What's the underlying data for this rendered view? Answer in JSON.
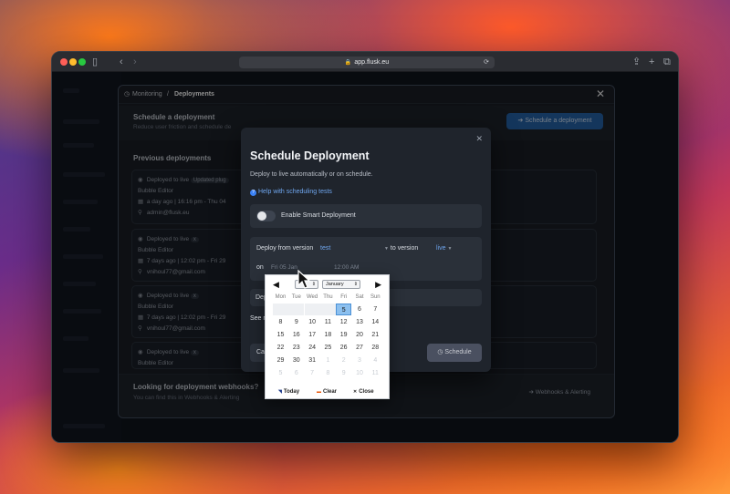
{
  "browser": {
    "url": "app.flusk.eu"
  },
  "header": {
    "crumb_monitoring": "Monitoring",
    "crumb_separator": "/",
    "crumb_deployments": "Deployments"
  },
  "schedule_section": {
    "title": "Schedule a deployment",
    "subtitle": "Reduce user friction and schedule de",
    "button": "Schedule a deployment"
  },
  "previous": {
    "title": "Previous deployments",
    "cards": [
      {
        "status": "Deployed to live",
        "tag": "Updated plug",
        "app": "Bubble Editor",
        "time": "a day ago | 16:16 pm - Thu 04",
        "user": "admin@flusk.eu"
      },
      {
        "status": "Deployed to live",
        "tag": "x",
        "app": "Bubble Editor",
        "time": "7 days ago | 12:02 pm - Fri 29",
        "user": "vnihoul77@gmail.com"
      },
      {
        "status": "Deployed to live",
        "tag": "x",
        "app": "Bubble Editor",
        "time": "7 days ago | 12:02 pm - Fri 29",
        "user": "vnihoul77@gmail.com"
      },
      {
        "status": "Deployed to live",
        "tag": "x",
        "app": "Bubble Editor"
      }
    ]
  },
  "webhooks": {
    "title": "Looking for deployment webhooks?",
    "subtitle": "You can find this in Webhooks & Alerting",
    "link": "Webhooks & Alerting"
  },
  "modal": {
    "title": "Schedule Deployment",
    "description": "Deploy to live automatically or on schedule.",
    "help_link": "Help with scheduling tests",
    "smart_label": "Enable Smart Deployment",
    "deploy_from_label": "Deploy from version",
    "from_version": "test",
    "to_version_label": "to version",
    "to_version": "live",
    "on_label": "on",
    "date_placeholder": "Fri 05 Jan",
    "time_placeholder": "12:00 AM",
    "row2_label": "Dep",
    "see_text": "See re",
    "cancel": "Ca",
    "schedule": "Schedule"
  },
  "calendar": {
    "month": "January",
    "year": "",
    "weekdays": [
      "Mon",
      "Tue",
      "Wed",
      "Thu",
      "Fri",
      "Sat",
      "Sun"
    ],
    "rows": [
      [
        "",
        "",
        "",
        "",
        "5",
        "6",
        "7"
      ],
      [
        "8",
        "9",
        "10",
        "11",
        "12",
        "13",
        "14"
      ],
      [
        "15",
        "16",
        "17",
        "18",
        "19",
        "20",
        "21"
      ],
      [
        "22",
        "23",
        "24",
        "25",
        "26",
        "27",
        "28"
      ],
      [
        "29",
        "30",
        "31",
        "1",
        "2",
        "3",
        "4"
      ],
      [
        "5",
        "6",
        "7",
        "8",
        "9",
        "10",
        "11"
      ]
    ],
    "selected_day": "5",
    "footer": {
      "today": "Today",
      "clear": "Clear",
      "close": "Close"
    },
    "colors": {
      "selected": "#8cc0ef",
      "today_mark": "#1e3a8a",
      "clear_mark": "#ea580c",
      "close_mark": "#111111"
    }
  },
  "colors": {
    "accent_blue": "#2563a8",
    "link_blue": "#6fa6ee",
    "panel_bg": "#1a1e25",
    "modal_bg": "#1f242c"
  }
}
